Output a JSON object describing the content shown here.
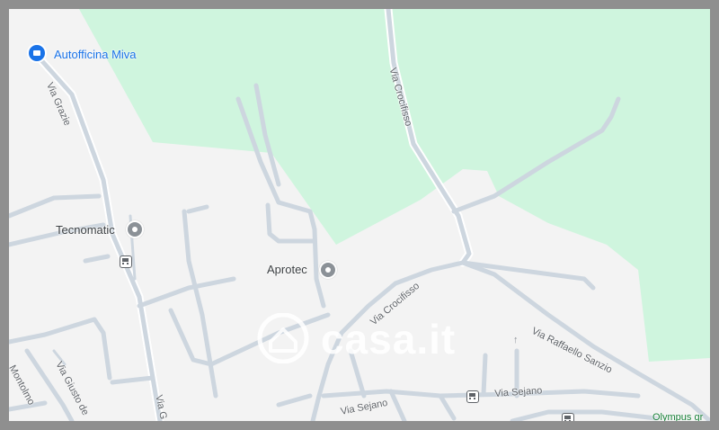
{
  "map": {
    "colors": {
      "background": "#f3f3f3",
      "park": "#cff5de",
      "road": "#cdd6df",
      "frame": "#8f8f8f",
      "poi_blue": "#1a73e8",
      "poi_green": "#188038"
    },
    "pois": [
      {
        "name": "Autofficina Miva",
        "icon": "car-repair-icon",
        "style": "blue"
      },
      {
        "name": "Tecnomatic",
        "icon": "place-pin-icon",
        "style": "gray"
      },
      {
        "name": "Aprotec",
        "icon": "place-pin-icon",
        "style": "gray"
      },
      {
        "name": "Olympus gr",
        "icon": "",
        "style": "green"
      }
    ],
    "streets": [
      {
        "name": "Via Grazie"
      },
      {
        "name": "Via Crocifisso"
      },
      {
        "name": "Via Crocifisso"
      },
      {
        "name": "Via Raffaello Sanzio"
      },
      {
        "name": "Via Sejano"
      },
      {
        "name": "Via Sejano"
      },
      {
        "name": "Via Giusto de"
      },
      {
        "name": "Montolmo"
      },
      {
        "name": "Via G"
      }
    ],
    "transit_icons": [
      "bus-stop-icon",
      "bus-stop-icon",
      "bus-stop-icon"
    ],
    "watermark": {
      "text": "casa.it",
      "icon": "house-logo-icon"
    }
  }
}
